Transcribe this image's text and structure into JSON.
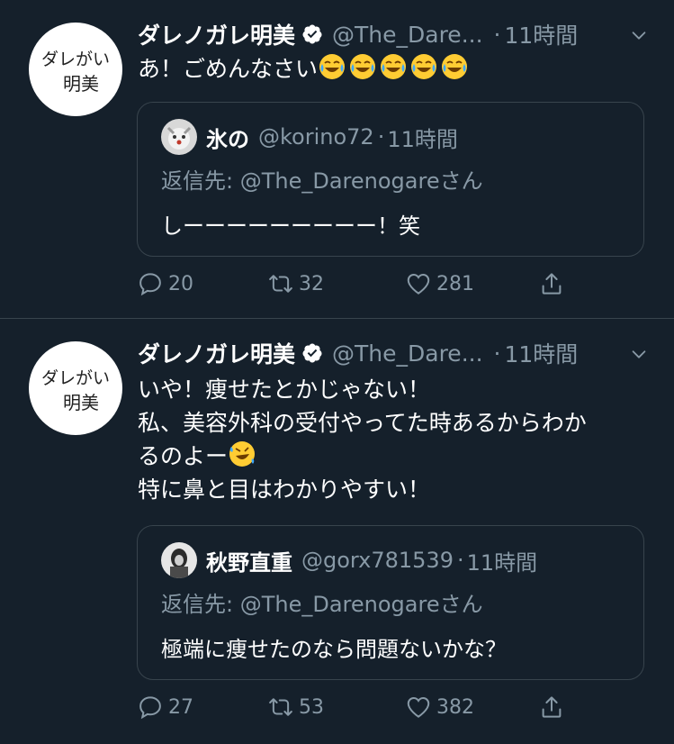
{
  "tweets": [
    {
      "name": "ダレノガレ明美",
      "handle": "@The_Dare...",
      "dot": "·",
      "time": "11時間",
      "text": "あ！ごめんなさい",
      "emoji": [
        "joy",
        "joy",
        "joy",
        "joy",
        "joy"
      ],
      "quote": {
        "name": "氷の",
        "handle": "@korino72",
        "dot": "·",
        "time": "11時間",
        "reply_prefix": "返信先: ",
        "reply_mention": "@The_Darenogare",
        "reply_suffix": "さん",
        "text": "しーーーーーーーーー！笑"
      },
      "counts": {
        "reply": "20",
        "retweet": "32",
        "like": "281"
      }
    },
    {
      "name": "ダレノガレ明美",
      "handle": "@The_Dare...",
      "dot": "·",
      "time": "11時間",
      "lines": [
        "いや！痩せたとかじゃない！",
        "私、美容外科の受付やってた時あるからわか",
        "るのよー",
        "特に鼻と目はわかりやすい！"
      ],
      "emoji_inline": "rofl",
      "quote": {
        "name": "秋野直重",
        "handle": "@gorx781539",
        "dot": "·",
        "time": "11時間",
        "reply_prefix": "返信先: ",
        "reply_mention": "@The_Darenogare",
        "reply_suffix": "さん",
        "text": "極端に痩せたのなら問題ないかな？"
      },
      "counts": {
        "reply": "27",
        "retweet": "53",
        "like": "382"
      }
    }
  ],
  "avatar_text": [
    "ダレがい",
    "明美"
  ],
  "icons": {
    "verified": "verified-badge-icon",
    "caret": "chevron-down-icon",
    "reply": "reply-bubble-icon",
    "retweet": "retweet-icon",
    "like": "heart-icon",
    "share": "share-icon"
  },
  "colors": {
    "background": "#15202b",
    "secondary": "#8899a6",
    "border": "#38444d"
  }
}
